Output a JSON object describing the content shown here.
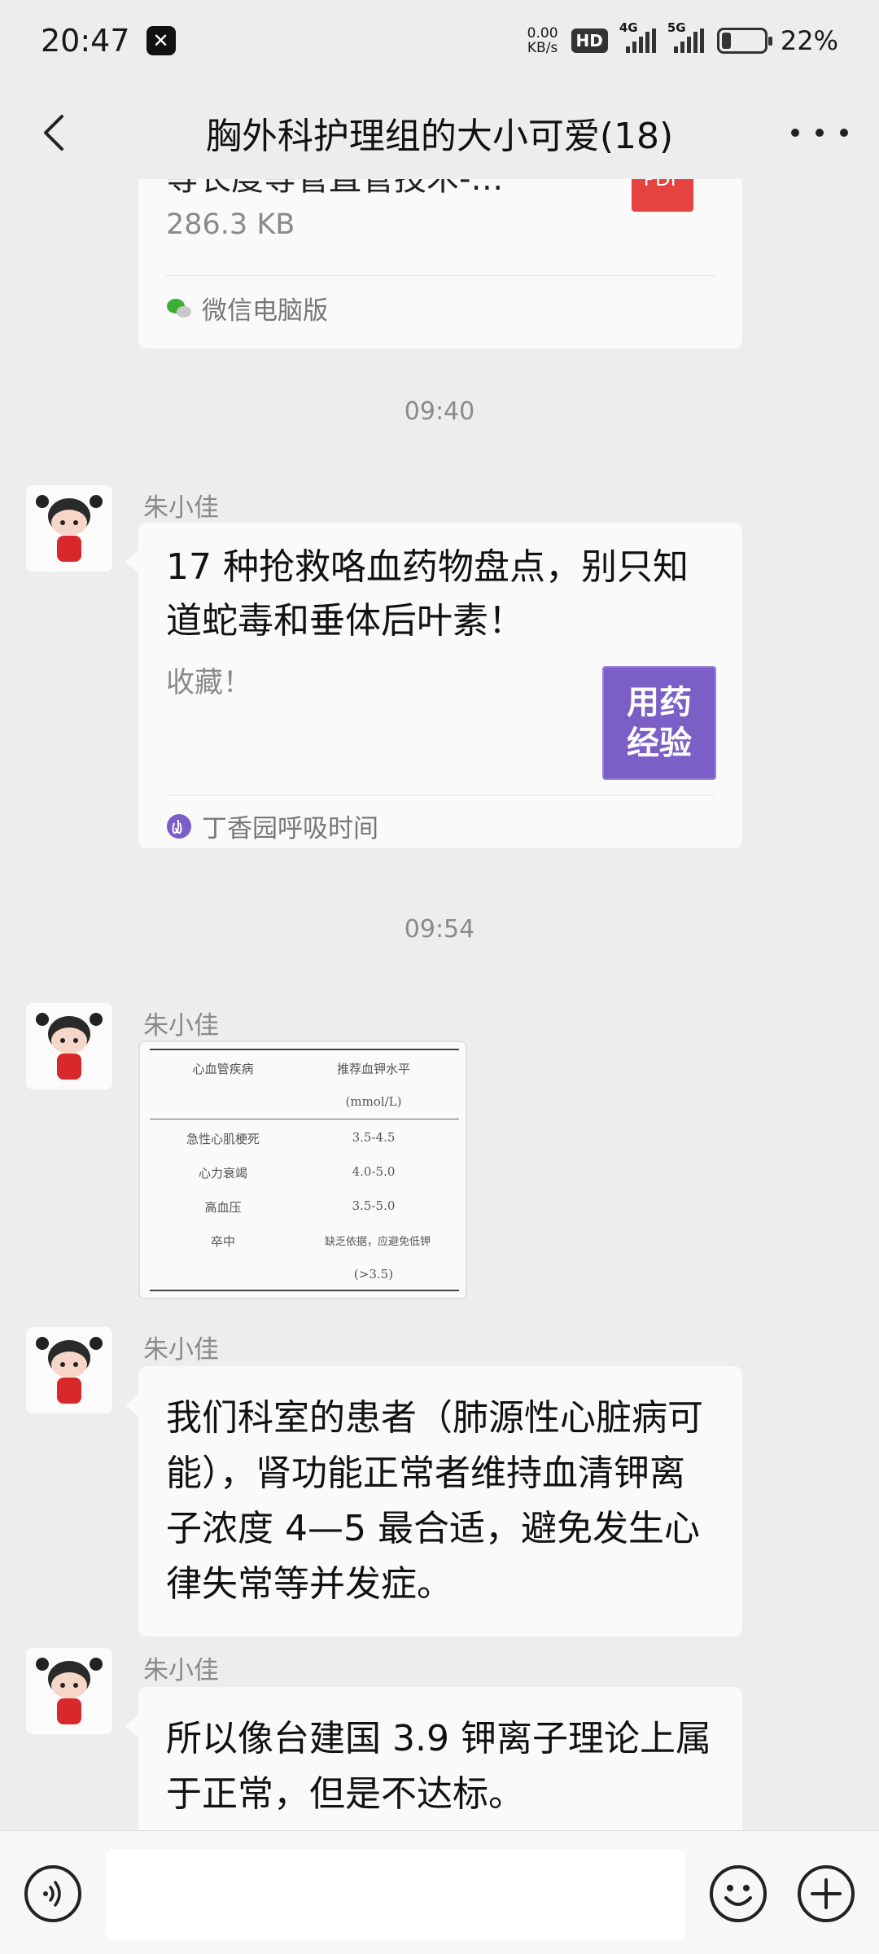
{
  "status_bar": {
    "time": "20:47",
    "net_speed_value": "0.00",
    "net_speed_unit": "KB/s",
    "hd_label": "HD",
    "sig1_label": "4G",
    "sig2_label": "5G",
    "battery_percent": 22,
    "battery_text": "22%"
  },
  "header": {
    "title": "胸外科护理组的大小可爱(18)"
  },
  "chat": {
    "file_card": {
      "file_name": "等长度等管直管技术-…",
      "file_size": "286.3 KB",
      "file_type": "PDF",
      "source": "微信电脑版"
    },
    "time1": "09:40",
    "msg1": {
      "sender": "朱小佳",
      "link_title": "17 种抢救咯血药物盘点，别只知道蛇毒和垂体后叶素！",
      "link_desc": "收藏！",
      "thumb_line1": "用药",
      "thumb_line2": "经验",
      "source": "丁香园呼吸时间"
    },
    "time2": "09:54",
    "msg2": {
      "sender": "朱小佳",
      "table": {
        "headers": [
          "心血管疾病",
          "推荐血钾水平"
        ],
        "unit": "(mmol/L)",
        "rows": [
          [
            "急性心肌梗死",
            "3.5-4.5"
          ],
          [
            "心力衰竭",
            "4.0-5.0"
          ],
          [
            "高血压",
            "3.5-5.0"
          ],
          [
            "卒中",
            "缺乏依据，应避免低钾"
          ]
        ],
        "last_note": "(>3.5)"
      }
    },
    "msg3": {
      "sender": "朱小佳",
      "text": "我们科室的患者（肺源性心脏病可能），肾功能正常者维持血清钾离子浓度 4—5 最合适，避免发生心律失常等并发症。"
    },
    "msg4": {
      "sender": "朱小佳",
      "text": "所以像台建国 3.9 钾离子理论上属于正常，但是不达标。"
    }
  },
  "input_bar": {
    "placeholder": ""
  },
  "colors": {
    "background": "#ededed",
    "bubble": "#fafafa",
    "pdf_red": "#e64340",
    "thumb_purple": "#7b5ec6"
  }
}
